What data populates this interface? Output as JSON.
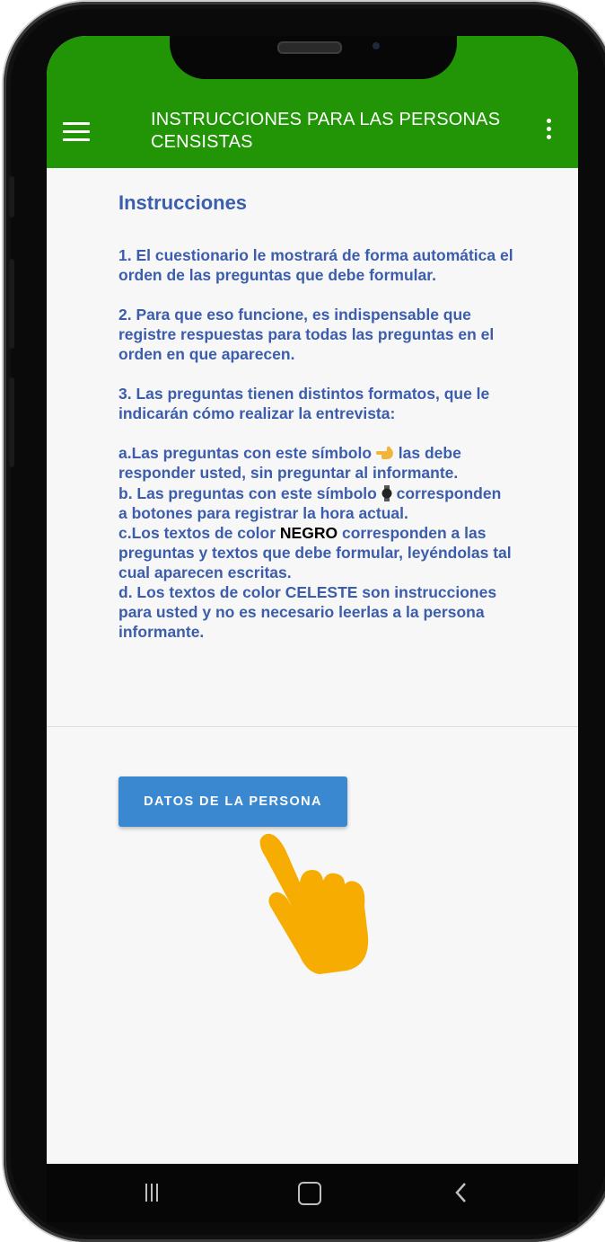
{
  "appbar": {
    "title": "INSTRUCCIONES PARA LAS PERSONAS CENSISTAS",
    "menu_icon": "hamburger-menu-icon",
    "more_icon": "more-vertical-icon",
    "color": "#219506"
  },
  "instructions": {
    "heading": "Instrucciones",
    "item1": "1. El cuestionario le mostrará de forma automática el orden de las preguntas que debe formular.",
    "item2": "2. Para que eso funcione, es indispensable que registre respuestas para todas las preguntas en el orden en que aparecen.",
    "item3": "3. Las preguntas tienen distintos formatos, que le indicarán cómo realizar la entrevista:",
    "a_prefix": "a.Las preguntas con este símbolo",
    "a_suffix": "las debe responder usted, sin preguntar al informante.",
    "b_prefix": "b.   Las preguntas con este símbolo",
    "b_suffix": "corresponden a botones para registrar la hora actual.",
    "c_prefix": "c.Los textos de color",
    "c_highlight": "NEGRO",
    "c_suffix": "corresponden a las preguntas y textos que debe formular, leyéndolas tal cual aparecen escritas.",
    "d": "d.   Los textos de color CELESTE son instrucciones para usted y no es necesario leerlas a la persona informante.",
    "text_color": "#3b5dab"
  },
  "action": {
    "button_label": "DATOS DE LA PERSONA",
    "button_color": "#3a88cf"
  },
  "navbar": {
    "recents_icon": "recents-icon",
    "home_icon": "home-icon",
    "back_icon": "back-chevron-icon"
  }
}
